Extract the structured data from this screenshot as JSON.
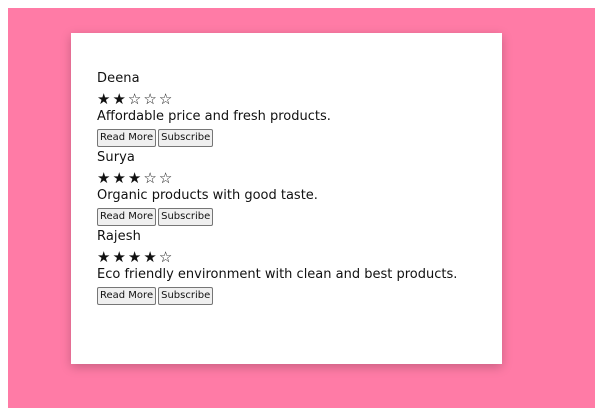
{
  "reviews": [
    {
      "name": "Deena",
      "rating": 2,
      "max_rating": 5,
      "text": "Affordable price and fresh products.",
      "read_more_label": "Read More",
      "subscribe_label": "Subscribe"
    },
    {
      "name": "Surya",
      "rating": 3,
      "max_rating": 5,
      "text": "Organic products with good taste.",
      "read_more_label": "Read More",
      "subscribe_label": "Subscribe"
    },
    {
      "name": "Rajesh",
      "rating": 4,
      "max_rating": 5,
      "text": "Eco friendly environment with clean and best products.",
      "read_more_label": "Read More",
      "subscribe_label": "Subscribe"
    }
  ],
  "colors": {
    "page_background": "#ff7ba6",
    "card_background": "#ffffff"
  },
  "icons": {
    "filled_star": "filled-star-icon",
    "empty_star": "empty-star-icon"
  }
}
